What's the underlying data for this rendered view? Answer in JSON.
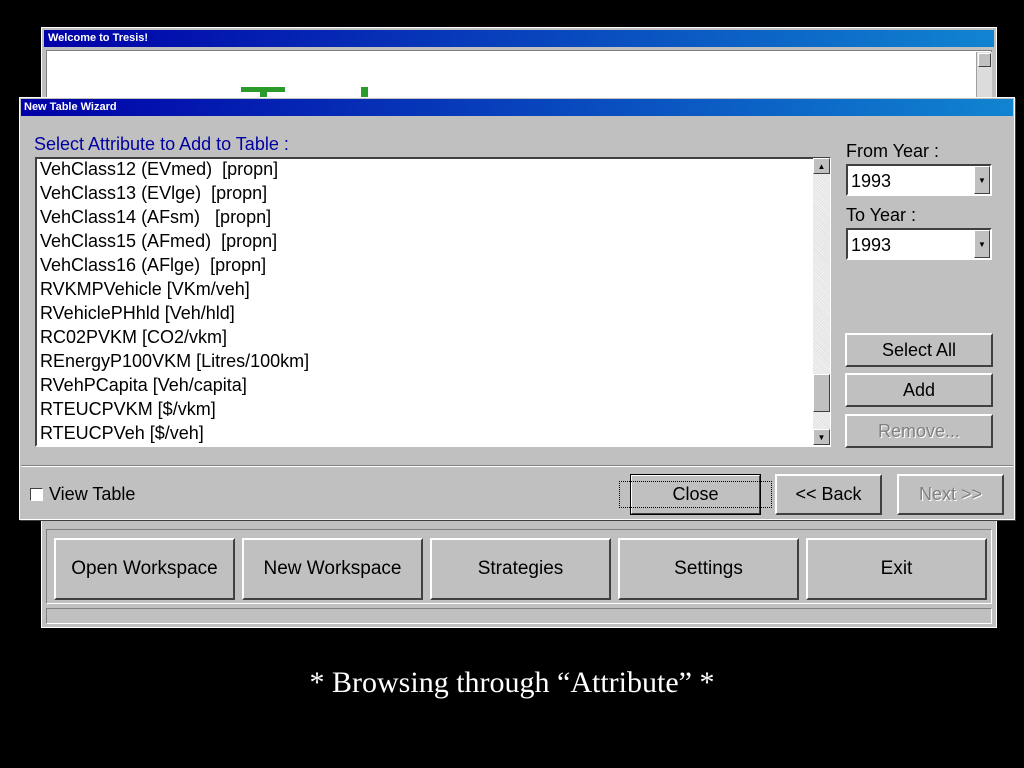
{
  "main_window": {
    "title": "Welcome to Tresis!",
    "logo_color": "#2a9a2a",
    "buttons": [
      "Open Workspace",
      "New Workspace",
      "Strategies",
      "Settings",
      "Exit"
    ]
  },
  "dialog": {
    "title": "New Table Wizard",
    "attribute_label": "Select Attribute to Add to Table :",
    "attributes": [
      "VehClass12 (EVmed)  [propn]",
      "VehClass13 (EVlge)  [propn]",
      "VehClass14 (AFsm)   [propn]",
      "VehClass15 (AFmed)  [propn]",
      "VehClass16 (AFlge)  [propn]",
      "RVKMPVehicle [VKm/veh]",
      "RVehiclePHhld [Veh/hld]",
      "RC02PVKM [CO2/vkm]",
      "REnergyP100VKM [Litres/100km]",
      "RVehPCapita [Veh/capita]",
      "RTEUCPVKM [$/vkm]",
      "RTEUCPVeh [$/veh]"
    ],
    "from_year_label": "From Year :",
    "from_year_value": "1993",
    "to_year_label": "To Year :",
    "to_year_value": "1993",
    "select_all_label": "Select All",
    "add_label": "Add",
    "remove_label": "Remove...",
    "view_table_label": "View Table",
    "view_table_checked": false,
    "close_label": "Close",
    "back_label": "<< Back",
    "next_label": "Next >>"
  },
  "caption": "* Browsing through “Attribute” *",
  "colors": {
    "titlebar_start": "#0000a8",
    "titlebar_end": "#1084d0",
    "window_face": "#c0c0c0",
    "attribute_label_color": "#0000a0"
  }
}
